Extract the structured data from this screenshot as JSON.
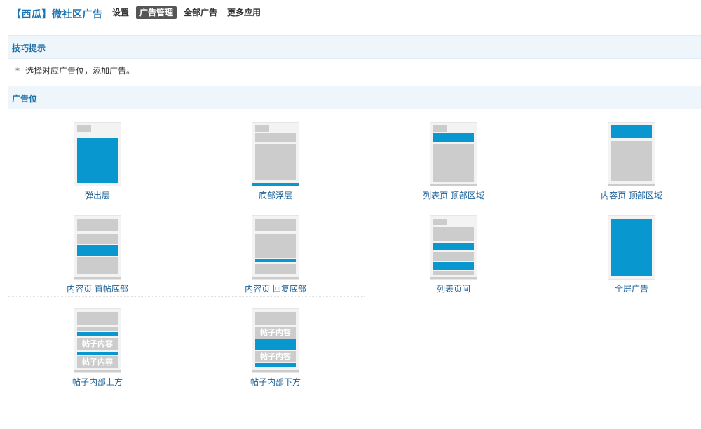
{
  "header": {
    "app_title": "【西瓜】微社区广告",
    "nav": [
      {
        "label": "设置",
        "active": false
      },
      {
        "label": "广告管理",
        "active": true
      },
      {
        "label": "全部广告",
        "active": false
      },
      {
        "label": "更多应用",
        "active": false
      }
    ]
  },
  "tips": {
    "title": "技巧提示",
    "text": "选择对应广告位，添加广告。",
    "bullet": "*"
  },
  "ad_positions": {
    "title": "广告位",
    "items": [
      {
        "label": "弹出层"
      },
      {
        "label": "底部浮层"
      },
      {
        "label": "列表页 顶部区域"
      },
      {
        "label": "内容页 顶部区域"
      },
      {
        "label": "内容页 首帖底部"
      },
      {
        "label": "内容页 回复底部"
      },
      {
        "label": "列表页间"
      },
      {
        "label": "全屏广告"
      },
      {
        "label": "帖子内部上方",
        "thumb_text": [
          "帖子内容",
          "帖子内容"
        ]
      },
      {
        "label": "帖子内部下方",
        "thumb_text": [
          "帖子内容",
          "帖子内容"
        ]
      }
    ]
  },
  "colors": {
    "accent": "#0997cf",
    "placeholder": "#cccccc",
    "section_bg": "#eef5fb",
    "title_blue": "#1a73b4"
  }
}
